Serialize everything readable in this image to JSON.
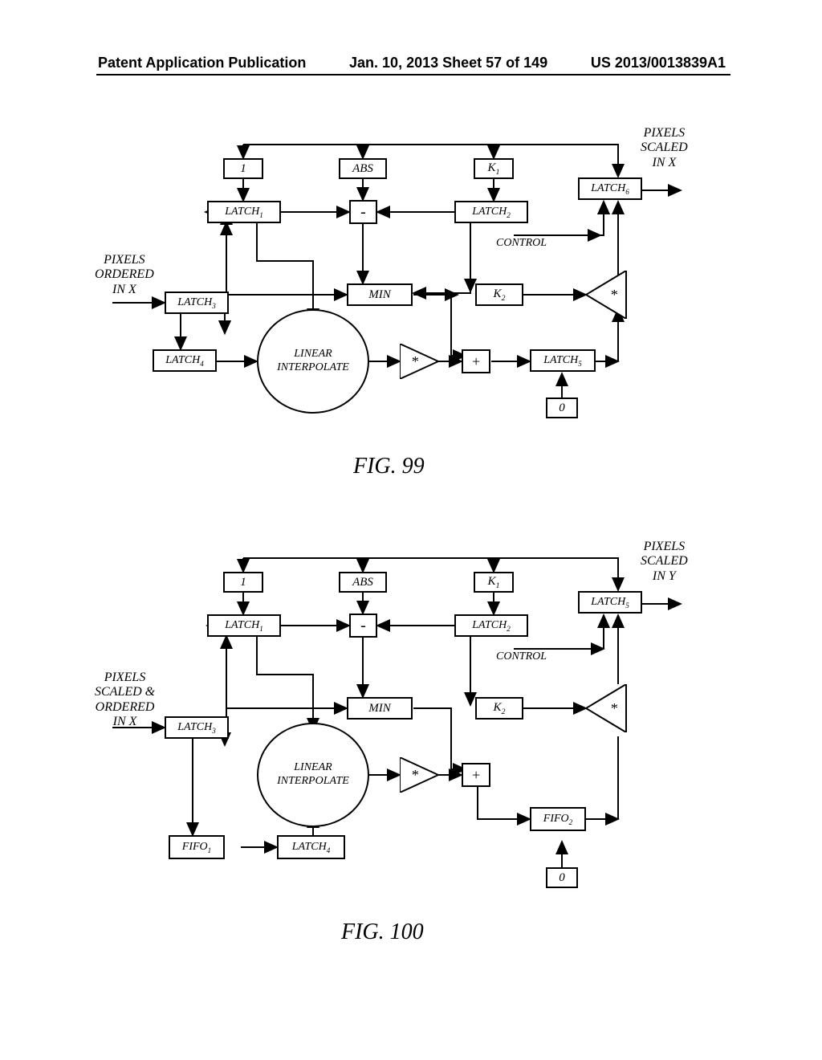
{
  "header": {
    "left": "Patent Application Publication",
    "center": "Jan. 10, 2013  Sheet 57 of 149",
    "right": "US 2013/0013839A1"
  },
  "fig99": {
    "caption": "FIG. 99",
    "input_label": "PIXELS\nORDERED\nIN X",
    "output_label": "PIXELS\nSCALED\nIN X",
    "control": "CONTROL",
    "one": "1",
    "abs": "ABS",
    "k1": "K",
    "k1s": "1",
    "k2": "K",
    "k2s": "2",
    "latch1": "LATCH",
    "latch2": "LATCH",
    "latch3": "LATCH",
    "latch4": "LATCH",
    "latch5": "LATCH",
    "latch6": "LATCH",
    "li": "LINEAR\nINTERPOLATE",
    "min": "MIN",
    "minus": "-",
    "mul": "*",
    "mul2": "*",
    "plus": "+",
    "zero": "0"
  },
  "fig100": {
    "caption": "FIG. 100",
    "input_label": "PIXELS\nSCALED &\nORDERED\nIN X",
    "output_label": "PIXELS\nSCALED\nIN Y",
    "control": "CONTROL",
    "one": "1",
    "abs": "ABS",
    "k1": "K",
    "k1s": "1",
    "k2": "K",
    "k2s": "2",
    "latch1": "LATCH",
    "latch2": "LATCH",
    "latch3": "LATCH",
    "latch4": "LATCH",
    "latch5": "LATCH",
    "fifo1": "FIFO",
    "fifo2": "FIFO",
    "li": "LINEAR\nINTERPOLATE",
    "min": "MIN",
    "minus": "-",
    "mul": "*",
    "mul2": "*",
    "plus": "+",
    "zero": "0"
  }
}
